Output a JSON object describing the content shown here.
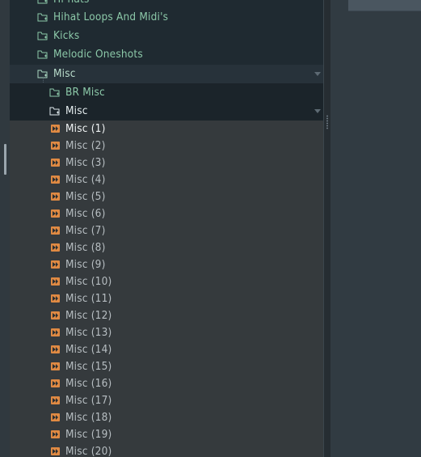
{
  "browser": {
    "folders": [
      {
        "key": "hihats",
        "label": "Hi-hats",
        "icon": "folder-icon"
      },
      {
        "key": "hihatloops",
        "label": "Hihat Loops And Midi's",
        "icon": "folder-icon"
      },
      {
        "key": "kicks",
        "label": "Kicks",
        "icon": "folder-icon"
      },
      {
        "key": "melodic",
        "label": "Melodic Oneshots",
        "icon": "folder-icon"
      },
      {
        "key": "misc-parent",
        "label": "Misc",
        "icon": "folder-icon",
        "expanded": true
      },
      {
        "key": "br-misc",
        "label": "BR Misc",
        "icon": "folder-icon"
      },
      {
        "key": "misc-child",
        "label": "Misc",
        "icon": "folder-icon",
        "expanded": true,
        "selected": true
      }
    ],
    "files": [
      "Misc (1)",
      "Misc (2)",
      "Misc (3)",
      "Misc (4)",
      "Misc (5)",
      "Misc (6)",
      "Misc (7)",
      "Misc (8)",
      "Misc (9)",
      "Misc (10)",
      "Misc (11)",
      "Misc (12)",
      "Misc (13)",
      "Misc (14)",
      "Misc (15)",
      "Misc (16)",
      "Misc (17)",
      "Misc (18)",
      "Misc (19)",
      "Misc (20)"
    ],
    "file_icon": "audio-file-icon",
    "colors": {
      "folder_text": "#8cc9a9",
      "file_text": "#b7bec2",
      "file_icon": "#e08a43",
      "panel_bg": "#1f2a31",
      "list_bg": "#353a3d"
    }
  }
}
